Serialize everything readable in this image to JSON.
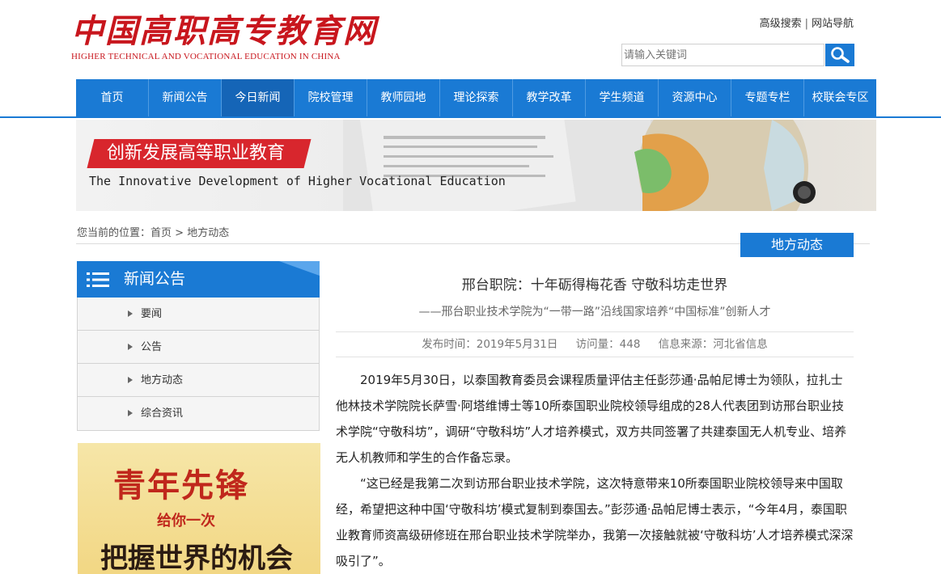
{
  "header": {
    "logo_cn": "中国高职高专教育网",
    "logo_en": "HIGHER TECHNICAL AND VOCATIONAL EDUCATION IN CHINA",
    "links": [
      "高级搜索",
      "网站导航"
    ],
    "search_placeholder": "请输入关键词"
  },
  "nav": {
    "items": [
      "首页",
      "新闻公告",
      "今日新闻",
      "院校管理",
      "教师园地",
      "理论探索",
      "教学改革",
      "学生频道",
      "资源中心",
      "专题专栏",
      "校联会专区"
    ],
    "active_index": 2
  },
  "banner": {
    "title": "创新发展高等职业教育",
    "subtitle": "The Innovative Development of Higher Vocational Education"
  },
  "breadcrumb": {
    "prefix": "您当前的位置：",
    "home": "首页",
    "separator": ">",
    "current": "地方动态"
  },
  "section_tab": "地方动态",
  "sidebar": {
    "title": "新闻公告",
    "items": [
      "要闻",
      "公告",
      "地方动态",
      "综合资讯"
    ]
  },
  "promo": {
    "line1": "青年先锋",
    "line2": "给你一次",
    "line3": "把握世界的机会"
  },
  "article": {
    "title": "邢台职院：十年砺得梅花香 守敬科坊走世界",
    "subtitle": "——邢台职业技术学院为“一带一路”沿线国家培养“中国标准”创新人才",
    "meta": {
      "date": "发布时间：2019年5月31日",
      "views": "访问量：448",
      "source": "信息来源：河北省信息"
    },
    "paragraphs": [
      "2019年5月30日，以泰国教育委员会课程质量评估主任彭莎通·品帕尼博士为领队，拉扎士他林技术学院院长萨雪·阿塔维博士等10所泰国职业院校领导组成的28人代表团到访邢台职业技术学院“守敬科坊”，调研“守敬科坊”人才培养模式，双方共同签署了共建泰国无人机专业、培养无人机教师和学生的合作备忘录。",
      "“这已经是我第二次到访邢台职业技术学院，这次特意带来10所泰国职业院校领导来中国取经，希望把这种中国‘守敬科坊’模式复制到泰国去。”彭莎通·品帕尼博士表示，“今年4月，泰国职业教育师资高级研修班在邢台职业技术学院举办，我第一次接触就被‘守敬科坊’人才培养模式深深吸引了”。"
    ]
  },
  "colors": {
    "brand_blue": "#1a7ad4",
    "brand_red": "#c8161d"
  }
}
